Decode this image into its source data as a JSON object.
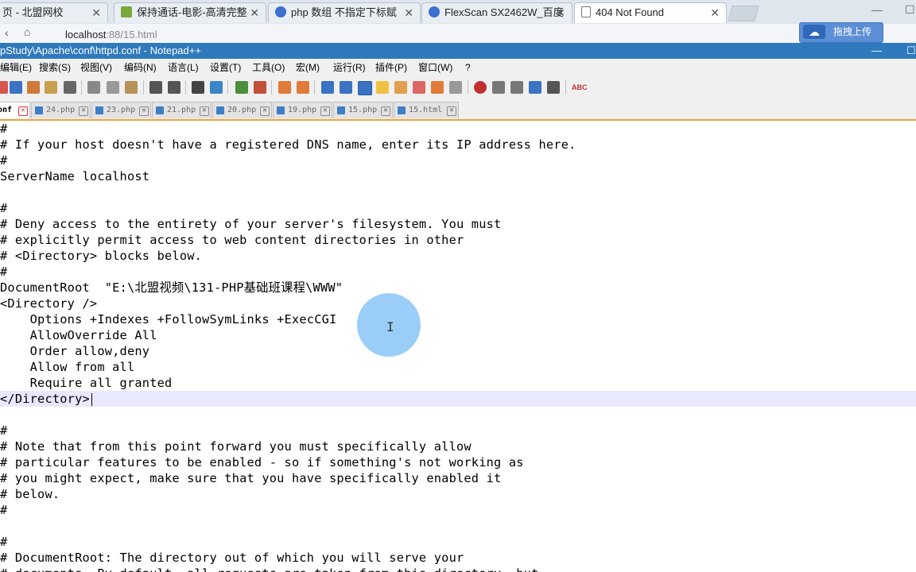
{
  "browser": {
    "tabs": [
      {
        "label": "页 - 北盟网校",
        "icon": "page-icon"
      },
      {
        "label": "保持通话-电影-高清完整",
        "icon": "video-icon"
      },
      {
        "label": "php 数组 不指定下标赋",
        "icon": "paw-icon"
      },
      {
        "label": "FlexScan SX2462W_百度",
        "icon": "paw-icon"
      },
      {
        "label": "404 Not Found",
        "icon": "page-icon"
      }
    ],
    "address": {
      "host": "localhost",
      "port_path": ":88/15.html"
    },
    "upload_label": "拖拽上传"
  },
  "notepad": {
    "title": "pStudy\\Apache\\conf\\httpd.conf - Notepad++",
    "menu": [
      "编辑(E)",
      "搜索(S)",
      "视图(V)",
      "编码(N)",
      "语言(L)",
      "设置(T)",
      "工具(O)",
      "宏(M)",
      "运行(R)",
      "插件(P)",
      "窗口(W)",
      "?"
    ],
    "doc_tabs": [
      "onf",
      "24.php",
      "23.php",
      "21.php",
      "20.php",
      "19.php",
      "15.php",
      "15.html"
    ],
    "lines": [
      "#",
      "# If your host doesn't have a registered DNS name, enter its IP address here.",
      "#",
      "ServerName localhost",
      "",
      "#",
      "# Deny access to the entirety of your server's filesystem. You must",
      "# explicitly permit access to web content directories in other",
      "# <Directory> blocks below.",
      "#",
      "DocumentRoot  \"E:\\北盟视频\\131-PHP基础班课程\\WWW\"",
      "<Directory />",
      "    Options +Indexes +FollowSymLinks +ExecCGI",
      "    AllowOverride All",
      "    Order allow,deny",
      "    Allow from all",
      "    Require all granted",
      "</Directory>",
      "",
      "#",
      "# Note that from this point forward you must specifically allow",
      "# particular features to be enabled - so if something's not working as",
      "# you might expect, make sure that you have specifically enabled it",
      "# below.",
      "#",
      "",
      "#",
      "# DocumentRoot: The directory out of which you will serve your",
      "# documents. By default, all requests are taken from this directory, but"
    ]
  },
  "colors": {
    "title_bar": "#2f79bd",
    "current_line": "#e8e8ff",
    "active_tab_border": "#f3a33a"
  }
}
